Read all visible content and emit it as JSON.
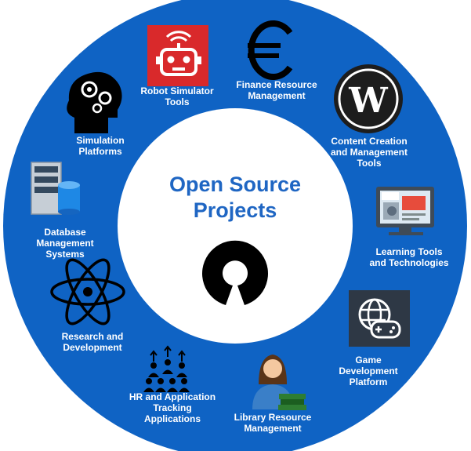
{
  "title": {
    "line1": "Open Source",
    "line2": "Projects"
  },
  "colors": {
    "ring": "#0f63c4",
    "title": "#1f66c3",
    "label": "#ffffff",
    "center": "#ffffff"
  },
  "items": [
    {
      "icon": "robot-icon",
      "lines": [
        "Robot Simulator",
        "Tools"
      ]
    },
    {
      "icon": "euro-icon",
      "lines": [
        "Finance Resource",
        "Management"
      ]
    },
    {
      "icon": "wordpress-icon",
      "lines": [
        "Content Creation",
        "and Management",
        "Tools"
      ]
    },
    {
      "icon": "monitor-html-icon",
      "lines": [
        "Learning Tools",
        "and Technologies"
      ]
    },
    {
      "icon": "game-controller-globe-icon",
      "lines": [
        "Game",
        "Development",
        "Platform"
      ]
    },
    {
      "icon": "librarian-books-icon",
      "lines": [
        "Library Resource",
        "Management"
      ]
    },
    {
      "icon": "people-group-icon",
      "lines": [
        "HR and Application",
        "Tracking",
        "Applications"
      ]
    },
    {
      "icon": "atom-icon",
      "lines": [
        "Research and",
        "Development"
      ]
    },
    {
      "icon": "database-server-icon",
      "lines": [
        "Database",
        "Management",
        "Systems"
      ]
    },
    {
      "icon": "brain-gears-icon",
      "lines": [
        "Simulation",
        "Platforms"
      ]
    }
  ],
  "center_logo": "open-source-logo-icon"
}
